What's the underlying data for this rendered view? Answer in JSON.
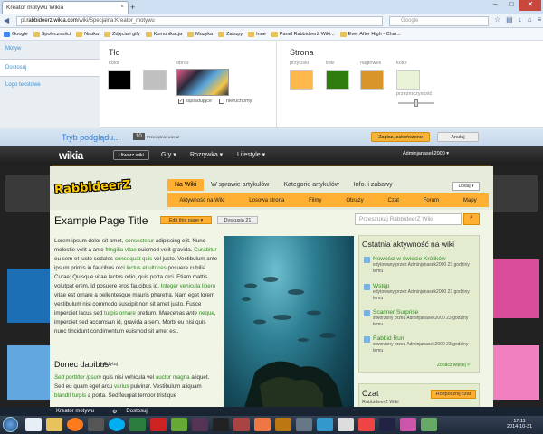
{
  "browser": {
    "tab_title": "Kreator motywu Wikia",
    "new_tab_icon": "plus-icon",
    "url_prefix": "pl.",
    "url_domain": "rabbideerz.wikia.com",
    "url_path": "/wiki/Specjalna:Kreator_motywu",
    "search_placeholder": "Google"
  },
  "bookmarks": [
    {
      "label": "Google",
      "icon": "google-icon"
    },
    {
      "label": "Społeczności",
      "icon": "folder-icon"
    },
    {
      "label": "Nauka",
      "icon": "folder-icon"
    },
    {
      "label": "Zdjęcia i gify",
      "icon": "folder-icon"
    },
    {
      "label": "Komunikacja",
      "icon": "folder-icon"
    },
    {
      "label": "Muzyka",
      "icon": "folder-icon"
    },
    {
      "label": "Zakupy",
      "icon": "folder-icon"
    },
    {
      "label": "Inne",
      "icon": "folder-icon"
    },
    {
      "label": "Panel RabbideerZ Wiki...",
      "icon": "wikia-icon"
    },
    {
      "label": "Ever After High - Char...",
      "icon": "eah-icon"
    }
  ],
  "designer": {
    "tabs": [
      {
        "label": "Motyw"
      },
      {
        "label": "Dostosuj"
      },
      {
        "label": "Logo tekstowe"
      }
    ],
    "background": {
      "title": "Tło",
      "color_label": "kolor",
      "color": "#000000",
      "image_label": "obraz",
      "tiling_label": "sąsiadujące",
      "fixed_label": "nieruchomy"
    },
    "page": {
      "title": "Strona",
      "buttons_label": "przyciski",
      "buttons_color": "#ffb84c",
      "links_label": "linki",
      "links_color": "#2e7d0e",
      "header_label": "nagłówek",
      "header_color": "#d8952a",
      "color_label": "kolor",
      "page_color": "#e9f3d8",
      "transparency_label": "przezroczystość"
    }
  },
  "preview_bar": {
    "title": "Tryb podglądu...",
    "width_value": "10",
    "width_label": "Przeciętnie wiersz",
    "save_label": "Zapisz, zakończono",
    "cancel_label": "Anuluj"
  },
  "wikia_bar": {
    "logo": "wikia",
    "create_wiki": "Utwórz wiki",
    "nav": [
      "Gry ▾",
      "Rozrywka ▾",
      "Lifestyle ▾"
    ],
    "user": "Adminjanasek2000 ▾"
  },
  "wiki": {
    "logo": "RabbideerZ",
    "tabs": [
      "Na Wiki",
      "W sprawie artykułów",
      "Kategorie artykułów",
      "Info. i zabawy"
    ],
    "subnav": [
      "Aktywność na Wiki",
      "Losowa strona",
      "Filmy",
      "Obrazy",
      "Czat",
      "Forum",
      "Mapy"
    ],
    "add_button": "Dodaj ▾",
    "page_title": "Example Page Title",
    "edit_button": "Edit this page ▾",
    "discussion_button": "Dyskusja 21",
    "search_placeholder": "Przeszukaj RabbideerZ Wiki",
    "section_heading": "Donec dapibus",
    "section_edit": "Edytuj"
  },
  "activity": {
    "title": "Ostatnia aktywność na wiki",
    "items": [
      {
        "title": "Nowości w świecie Królików",
        "meta": "edytowany przez Adminjanasek2000 23 godziny temu"
      },
      {
        "title": "Wstęp",
        "meta": "edytowany przez Adminjanasek2000 23 godziny temu"
      },
      {
        "title": "Scanner Surprise",
        "meta": "stworzony przez Adminjanasek2000 23 godziny temu"
      },
      {
        "title": "Rabbid Run",
        "meta": "stworzony przez Adminjanasek2000 23 godziny temu"
      }
    ],
    "more": "Zobacz więcej >"
  },
  "chat": {
    "title": "Czat",
    "button": "Rozpocznij czat",
    "subtitle": "RabbideerZ Wiki"
  },
  "taskbar": {
    "windows": [
      "Kreator motywu",
      "Dostosuj"
    ],
    "time": "17:11",
    "date": "2014-10-31"
  }
}
